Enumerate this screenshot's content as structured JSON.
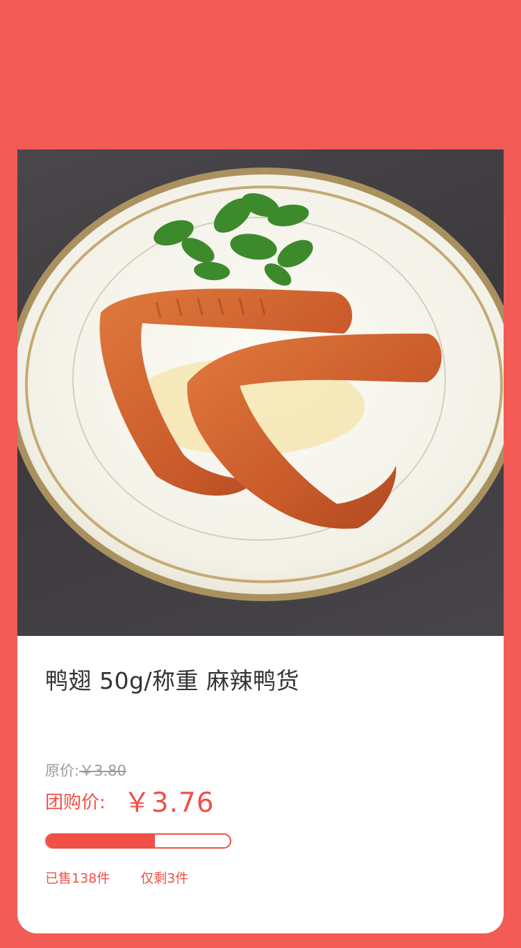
{
  "product": {
    "image_icon": "duck-wings-on-plate-photo",
    "title": "鸭翅 50g/称重 麻辣鸭货",
    "original_price_label": "原价:",
    "original_price": "￥3.80",
    "group_price_label": "团购价:",
    "group_price": "￥3.76",
    "sold_progress": 0.59,
    "sold_text": "已售138件",
    "remaining_text": "仅剩3件"
  },
  "colors": {
    "background": "#f35b57",
    "accent": "#f05047",
    "card": "#ffffff",
    "title_text": "#333333",
    "muted_text": "#9a9a9a"
  }
}
